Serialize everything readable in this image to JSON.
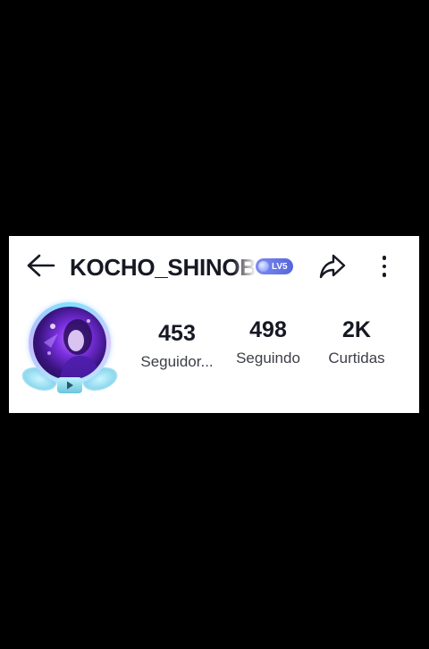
{
  "header": {
    "back_icon": "arrow-left-icon",
    "username": "KOCHO_SHINOBU",
    "level_badge": "LV5",
    "share_icon": "share-arrow-icon",
    "more_icon": "vertical-dots-icon"
  },
  "profile": {
    "avatar_icon": "avatar-frame-icon"
  },
  "stats": [
    {
      "value": "453",
      "label": "Seguidor..."
    },
    {
      "value": "498",
      "label": "Seguindo"
    },
    {
      "value": "2K",
      "label": "Curtidas"
    }
  ],
  "colors": {
    "background": "#000000",
    "card": "#ffffff",
    "text_primary": "#161823",
    "text_secondary": "#3d3f48",
    "badge": "#6677e8"
  }
}
